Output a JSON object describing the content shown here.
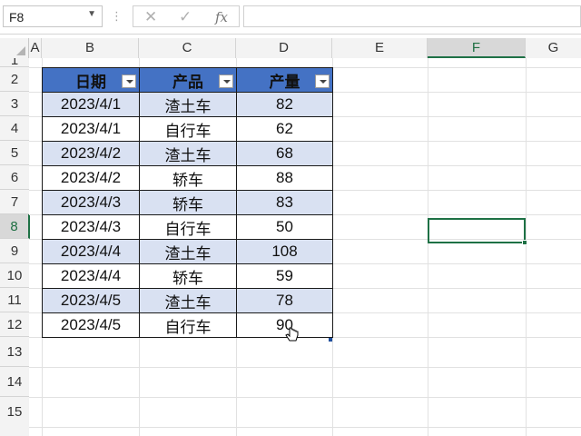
{
  "formula_bar": {
    "name_box": "F8",
    "formula": ""
  },
  "columns": [
    "A",
    "B",
    "C",
    "D",
    "E",
    "F",
    "G"
  ],
  "rows": [
    "1",
    "2",
    "3",
    "4",
    "5",
    "6",
    "7",
    "8",
    "9",
    "10",
    "11",
    "12",
    "13",
    "14",
    "15"
  ],
  "table": {
    "headers": [
      "日期",
      "产品",
      "产量"
    ],
    "rows": [
      [
        "2023/4/1",
        "渣土车",
        "82"
      ],
      [
        "2023/4/1",
        "自行车",
        "62"
      ],
      [
        "2023/4/2",
        "渣土车",
        "68"
      ],
      [
        "2023/4/2",
        "轿车",
        "88"
      ],
      [
        "2023/4/3",
        "轿车",
        "83"
      ],
      [
        "2023/4/3",
        "自行车",
        "50"
      ],
      [
        "2023/4/4",
        "渣土车",
        "108"
      ],
      [
        "2023/4/4",
        "轿车",
        "59"
      ],
      [
        "2023/4/5",
        "渣土车",
        "78"
      ],
      [
        "2023/4/5",
        "自行车",
        "90"
      ]
    ]
  },
  "selection": {
    "cell": "F8",
    "column": "F",
    "row": "8"
  },
  "colors": {
    "header_fill": "#4472c4",
    "band_fill": "#d9e1f2",
    "selection_border": "#1e7145"
  },
  "icons": {
    "cancel": "close-icon",
    "confirm": "check-icon",
    "function": "fx-icon",
    "filter": "filter-dropdown-icon"
  }
}
